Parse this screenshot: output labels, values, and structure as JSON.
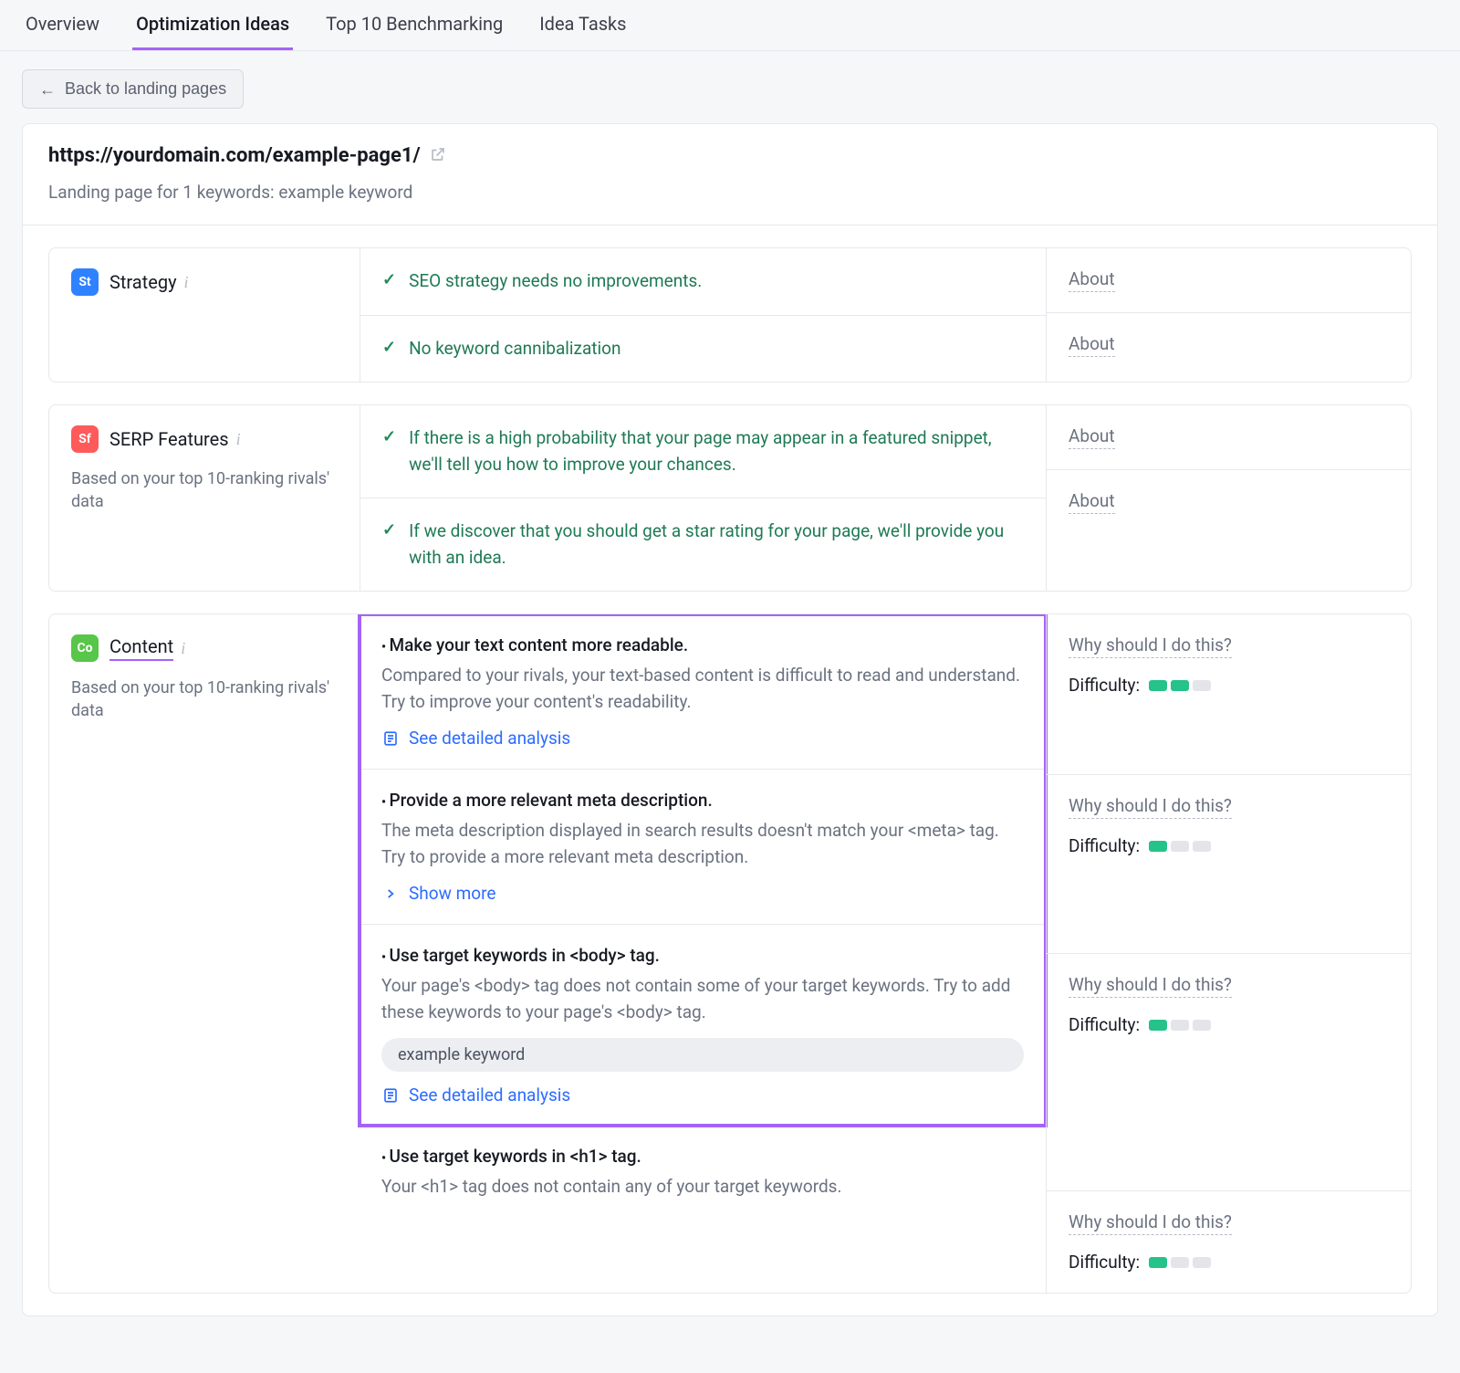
{
  "tabs": {
    "items": [
      "Overview",
      "Optimization Ideas",
      "Top 10 Benchmarking",
      "Idea Tasks"
    ],
    "activeIndex": 1
  },
  "back_button": "Back to landing pages",
  "header": {
    "url": "https://yourdomain.com/example-page1/",
    "subtitle": "Landing page for 1 keywords: example keyword"
  },
  "common": {
    "about": "About",
    "why": "Why should I do this?",
    "difficulty_label": "Difficulty:",
    "see_analysis": "See detailed analysis",
    "show_more": "Show more"
  },
  "sections": {
    "strategy": {
      "badge": "St",
      "title": "Strategy",
      "rows": [
        {
          "text": "SEO strategy needs no improvements."
        },
        {
          "text": "No keyword cannibalization"
        }
      ]
    },
    "serp": {
      "badge": "Sf",
      "title": "SERP Features",
      "subtitle": "Based on your top 10-ranking rivals' data",
      "rows": [
        {
          "text": "If there is a high probability that your page may appear in a featured snippet, we'll tell you how to improve your chances."
        },
        {
          "text": "If we discover that you should get a star rating for your page, we'll provide you with an idea."
        }
      ]
    },
    "content": {
      "badge": "Co",
      "title": "Content",
      "subtitle": "Based on your top 10-ranking rivals' data",
      "rows": [
        {
          "title": "Make your text content more readable.",
          "body": "Compared to your rivals, your text-based content is difficult to read and understand. Try to improve your content's readability.",
          "action": "analysis",
          "difficulty_on": 2
        },
        {
          "title": "Provide a more relevant meta description.",
          "body": "The meta description displayed in search results doesn't match your <meta> tag. Try to provide a more relevant meta description.",
          "action": "showmore",
          "difficulty_on": 1
        },
        {
          "title": "Use target keywords in <body> tag.",
          "body": "Your page's <body> tag does not contain some of your target keywords.\nTry to add these keywords to your page's <body> tag.",
          "pill": "example keyword",
          "action": "analysis",
          "difficulty_on": 1
        },
        {
          "title": "Use target keywords in <h1> tag.",
          "body": "Your <h1> tag does not contain any of your target keywords.",
          "action": "none",
          "difficulty_on": 1
        }
      ]
    }
  }
}
